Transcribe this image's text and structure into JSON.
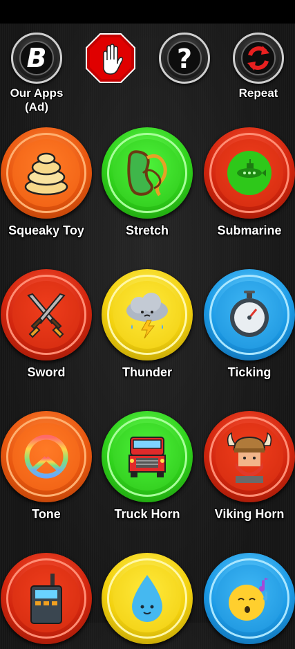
{
  "top_bar": {
    "items": [
      {
        "id": "our-apps",
        "label": "Our Apps\n(Ad)",
        "icon": "b-logo-icon"
      },
      {
        "id": "stop",
        "label": "",
        "icon": "stop-hand-icon"
      },
      {
        "id": "help",
        "label": "",
        "icon": "question-icon"
      },
      {
        "id": "repeat",
        "label": "Repeat",
        "icon": "repeat-icon"
      }
    ]
  },
  "sounds": [
    {
      "label": "Squeaky Toy",
      "color": "orange",
      "icon": "squeaky-toy-icon"
    },
    {
      "label": "Stretch",
      "color": "green",
      "icon": "stretch-icon"
    },
    {
      "label": "Submarine",
      "color": "red",
      "icon": "submarine-icon"
    },
    {
      "label": "Sword",
      "color": "red",
      "icon": "sword-icon"
    },
    {
      "label": "Thunder",
      "color": "yellow",
      "icon": "thunder-icon"
    },
    {
      "label": "Ticking",
      "color": "blue",
      "icon": "ticking-icon"
    },
    {
      "label": "Tone",
      "color": "orange",
      "icon": "tone-icon"
    },
    {
      "label": "Truck Horn",
      "color": "green",
      "icon": "truck-horn-icon"
    },
    {
      "label": "Viking Horn",
      "color": "red",
      "icon": "viking-horn-icon"
    },
    {
      "label": "",
      "color": "red",
      "icon": "walkie-talkie-icon"
    },
    {
      "label": "",
      "color": "yellow",
      "icon": "water-drop-icon"
    },
    {
      "label": "",
      "color": "blue",
      "icon": "whistle-icon"
    }
  ]
}
